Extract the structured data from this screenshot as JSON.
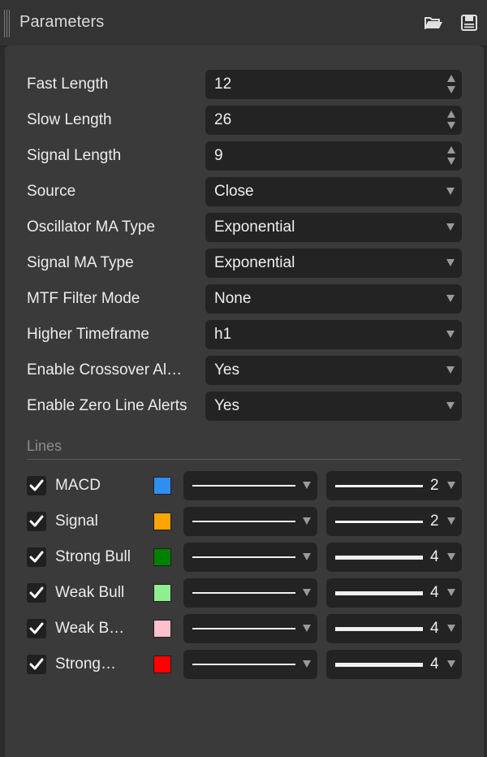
{
  "header": {
    "title": "Parameters",
    "open_icon": "folder-open-icon",
    "save_icon": "save-icon"
  },
  "params": [
    {
      "label": "Fast Length",
      "value": "12",
      "kind": "spinner"
    },
    {
      "label": "Slow Length",
      "value": "26",
      "kind": "spinner"
    },
    {
      "label": "Signal Length",
      "value": "9",
      "kind": "spinner"
    },
    {
      "label": "Source",
      "value": "Close",
      "kind": "dropdown"
    },
    {
      "label": "Oscillator MA Type",
      "value": "Exponential",
      "kind": "dropdown"
    },
    {
      "label": "Signal MA Type",
      "value": "Exponential",
      "kind": "dropdown"
    },
    {
      "label": "MTF Filter Mode",
      "value": "None",
      "kind": "dropdown"
    },
    {
      "label": "Higher Timeframe",
      "value": "h1",
      "kind": "dropdown"
    },
    {
      "label": "Enable Crossover Al…",
      "value": "Yes",
      "kind": "dropdown"
    },
    {
      "label": "Enable Zero Line Alerts",
      "value": "Yes",
      "kind": "dropdown"
    }
  ],
  "lines_section": {
    "title": "Lines",
    "items": [
      {
        "name": "MACD",
        "checked": true,
        "color": "#2f8ff0",
        "style": "solid",
        "width": "2"
      },
      {
        "name": "Signal",
        "checked": true,
        "color": "#ffa500",
        "style": "solid",
        "width": "2"
      },
      {
        "name": "Strong Bull",
        "checked": true,
        "color": "#008000",
        "style": "solid",
        "width": "4"
      },
      {
        "name": "Weak Bull",
        "checked": true,
        "color": "#90ee90",
        "style": "solid",
        "width": "4"
      },
      {
        "name": "Weak B…",
        "checked": true,
        "color": "#ffc0cb",
        "style": "solid",
        "width": "4"
      },
      {
        "name": "Strong…",
        "checked": true,
        "color": "#ff0000",
        "style": "solid",
        "width": "4"
      }
    ]
  }
}
